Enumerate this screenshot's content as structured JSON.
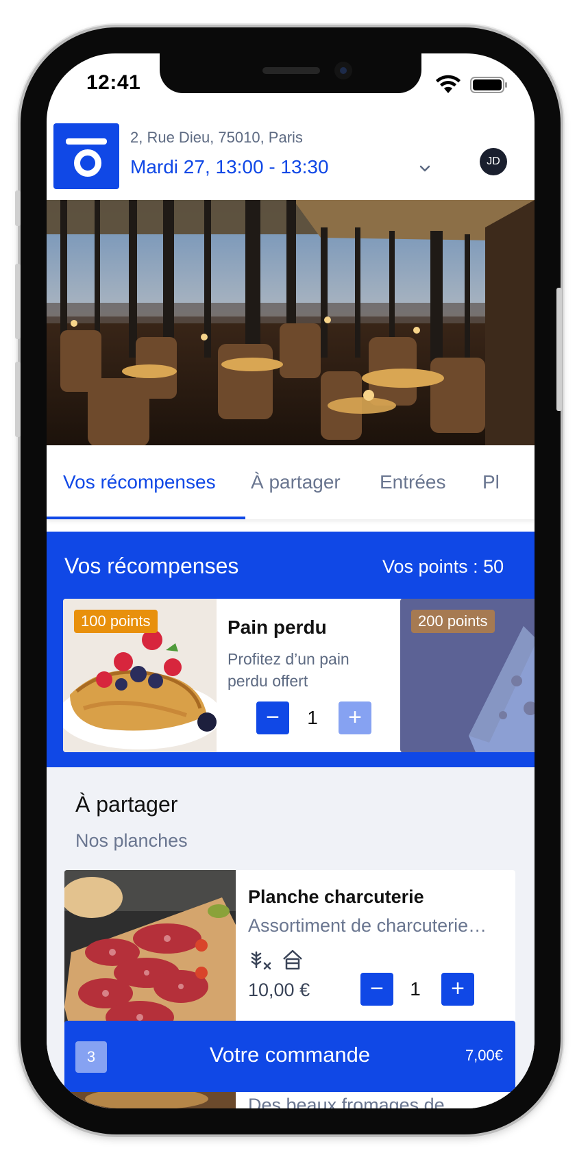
{
  "status_bar": {
    "time": "12:41"
  },
  "header": {
    "address": "2, Rue Dieu, 75010, Paris",
    "slot": "Mardi 27, 13:00 - 13:30",
    "avatar_initials": "JD"
  },
  "tabs": [
    {
      "label": "Vos récompenses",
      "active": true
    },
    {
      "label": "À partager",
      "active": false
    },
    {
      "label": "Entrées",
      "active": false
    },
    {
      "label": "Pl",
      "active": false
    }
  ],
  "rewards": {
    "title": "Vos récompenses",
    "points_label": "Vos points : 50",
    "cards": [
      {
        "badge": "100 points",
        "name": "Pain perdu",
        "description": "Profitez d’un pain perdu offert",
        "quantity": "1",
        "minus": "−",
        "plus": "+"
      },
      {
        "badge": "200 points"
      }
    ]
  },
  "share": {
    "title": "À partager",
    "subtitle": "Nos planches",
    "products": [
      {
        "name": "Planche charcuterie",
        "description": "Assortiment de charcuterie…",
        "allergens": [
          "gluten-free-icon",
          "house-icon"
        ],
        "price": "10,00 €",
        "quantity": "1",
        "minus": "−",
        "plus": "+"
      }
    ],
    "next_product_partial": "Des beaux fromages de"
  },
  "order_bar": {
    "count": "3",
    "label": "Votre commande",
    "total": "7,00€"
  },
  "colors": {
    "brand_blue": "#1048e6",
    "light_blue": "#86a2f2",
    "badge_orange": "#e8900c",
    "muted_text": "#6a7690",
    "section_bg": "#f0f2f7"
  }
}
